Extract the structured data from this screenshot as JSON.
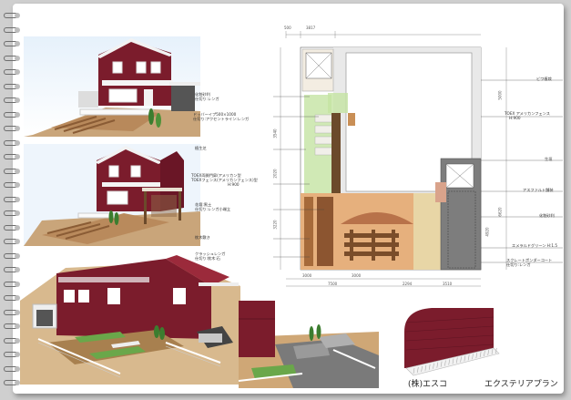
{
  "footer": {
    "company": "(株)エスコ",
    "title": "エクステリアプラン"
  },
  "plan_labels": {
    "left": [
      "化粧砂利",
      "仕切り:レンガ",
      "ドッバーイプ500×1000",
      "仕切り:アクセントライン:レンガ",
      "植生芝",
      "TOEX両開門扉(アメリカン型",
      "TOEXフェンス(アメリカンフェンス)型",
      "H:900",
      "花壇:黒土",
      "仕切り:レンガ小端立",
      "枕木敷き",
      "クラッシュレンガ",
      "仕切り:枕木:石"
    ],
    "right": [
      "ビワ植栽",
      "TOEX アメリカンフェンス",
      "H:900",
      "生垣",
      "アスファルト舗装",
      "化粧砂利",
      "エメラルドグリーン H:1.5",
      "スクレートボンダーコート",
      "仕切り:レンガ"
    ]
  },
  "dimensions": {
    "top": [
      "500",
      "3817"
    ],
    "bottom_row1": [
      "3000",
      "3000"
    ],
    "bottom_row2": [
      "7500",
      "2294",
      "3510"
    ],
    "left": [
      "3540",
      "2020",
      "3220"
    ],
    "right": [
      "5000",
      "6620",
      "4920"
    ]
  }
}
